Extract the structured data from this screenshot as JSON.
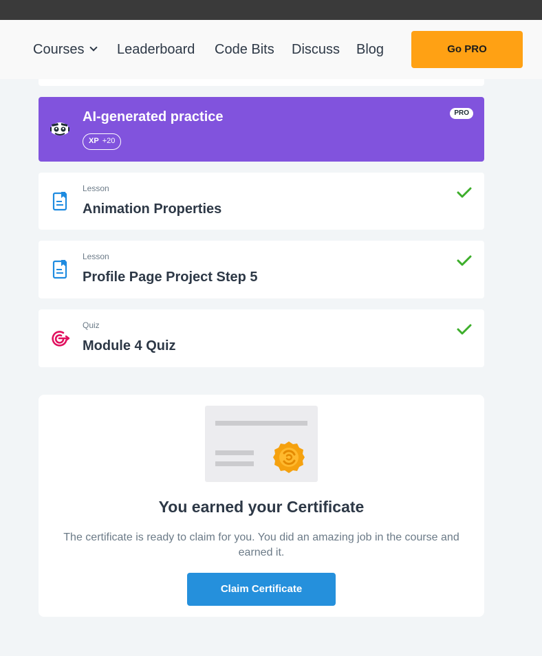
{
  "nav": {
    "courses": "Courses",
    "leaderboard": "Leaderboard",
    "code_bits": "Code Bits",
    "discuss": "Discuss",
    "blog": "Blog",
    "go_pro": "Go PRO"
  },
  "ai_practice": {
    "title": "AI-generated practice",
    "xp_label": "XP",
    "xp_value": "+20",
    "badge": "PRO",
    "icon": "bot-face-icon",
    "color": "#8153dd"
  },
  "items": [
    {
      "type": "Lesson",
      "title": "Animation Properties",
      "icon": "lesson-document-icon",
      "completed": true
    },
    {
      "type": "Lesson",
      "title": "Profile Page Project Step 5",
      "icon": "lesson-document-icon",
      "completed": true
    },
    {
      "type": "Quiz",
      "title": "Module 4 Quiz",
      "icon": "quiz-target-icon",
      "completed": true
    }
  ],
  "certificate": {
    "title": "You earned your Certificate",
    "description": "The certificate is ready to claim for you. You did an amazing job in the course and earned it.",
    "button": "Claim Certificate",
    "icon": "certificate-icon"
  },
  "colors": {
    "accent_pro": "#ffa114",
    "purple": "#8153dd",
    "primary_blue": "#2590dc",
    "check_green": "#3dae2b",
    "quiz_pink": "#e1105e",
    "lesson_blue": "#1e8be0"
  }
}
